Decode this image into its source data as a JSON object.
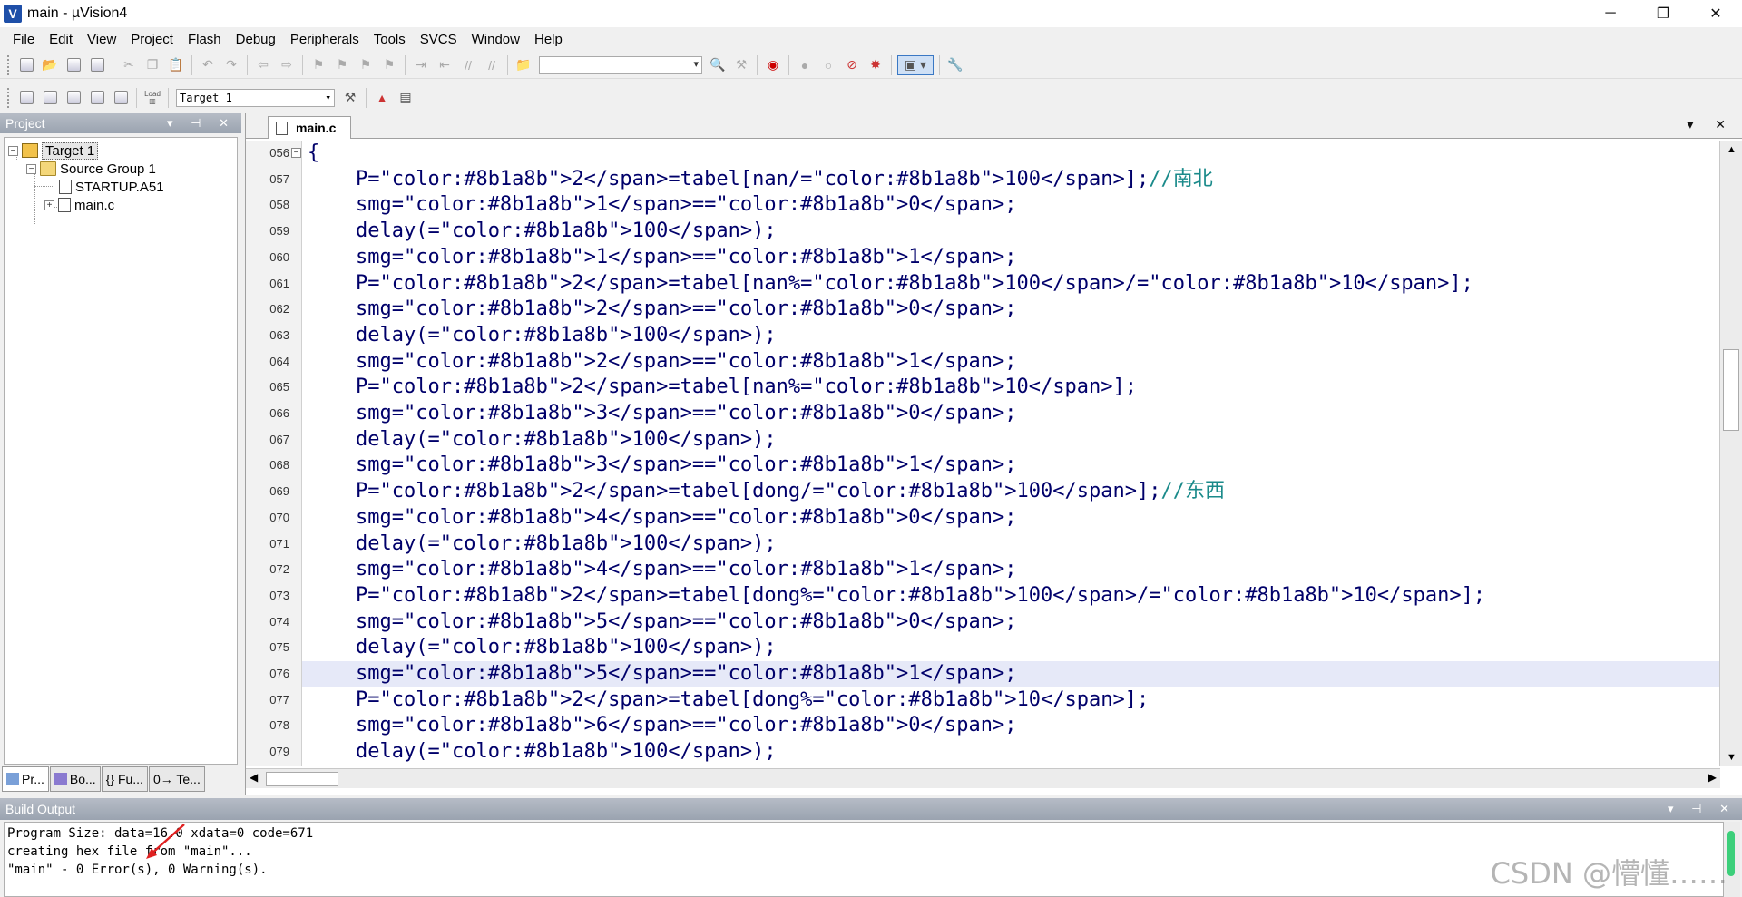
{
  "window": {
    "title": "main - µVision4",
    "app_icon_letter": "V",
    "minimize": "─",
    "maximize": "❐",
    "close": "✕"
  },
  "menu": [
    "File",
    "Edit",
    "View",
    "Project",
    "Flash",
    "Debug",
    "Peripherals",
    "Tools",
    "SVCS",
    "Window",
    "Help"
  ],
  "toolbar2": {
    "target_select": "Target 1",
    "load_label": "Load"
  },
  "project_panel": {
    "title": "Project",
    "controls": "▾ ⊣ ✕",
    "tree": {
      "target": "Target 1",
      "group": "Source Group 1",
      "files": [
        "STARTUP.A51",
        "main.c"
      ]
    },
    "tabs": [
      "Pr...",
      "Bo...",
      "{} Fu...",
      "0→ Te..."
    ]
  },
  "editor": {
    "tab_name": "main.c",
    "controls": "▾ ✕",
    "highlight_line": "076",
    "lines": [
      {
        "no": "056",
        "text": "{"
      },
      {
        "no": "057",
        "text": "    P2=tabel[nan/100];//南北"
      },
      {
        "no": "058",
        "text": "    smg1=0;"
      },
      {
        "no": "059",
        "text": "    delay(100);"
      },
      {
        "no": "060",
        "text": "    smg1=1;"
      },
      {
        "no": "061",
        "text": "    P2=tabel[nan%100/10];"
      },
      {
        "no": "062",
        "text": "    smg2=0;"
      },
      {
        "no": "063",
        "text": "    delay(100);"
      },
      {
        "no": "064",
        "text": "    smg2=1;"
      },
      {
        "no": "065",
        "text": "    P2=tabel[nan%10];"
      },
      {
        "no": "066",
        "text": "    smg3=0;"
      },
      {
        "no": "067",
        "text": "    delay(100);"
      },
      {
        "no": "068",
        "text": "    smg3=1;"
      },
      {
        "no": "069",
        "text": "    P2=tabel[dong/100];//东西"
      },
      {
        "no": "070",
        "text": "    smg4=0;"
      },
      {
        "no": "071",
        "text": "    delay(100);"
      },
      {
        "no": "072",
        "text": "    smg4=1;"
      },
      {
        "no": "073",
        "text": "    P2=tabel[dong%100/10];"
      },
      {
        "no": "074",
        "text": "    smg5=0;"
      },
      {
        "no": "075",
        "text": "    delay(100);"
      },
      {
        "no": "076",
        "text": "    smg5=1;"
      },
      {
        "no": "077",
        "text": "    P2=tabel[dong%10];"
      },
      {
        "no": "078",
        "text": "    smg6=0;"
      },
      {
        "no": "079",
        "text": "    delay(100);"
      }
    ]
  },
  "build_output": {
    "title": "Build Output",
    "controls": "▾ ⊣ ✕",
    "lines": [
      "Program Size: data=16.0 xdata=0 code=671",
      "creating hex file from \"main\"...",
      "\"main\" - 0 Error(s), 0 Warning(s)."
    ]
  },
  "watermark": "CSDN @懵懂……",
  "colors": {
    "code_text": "#00006a",
    "number": "#8b1a8b",
    "comment": "#1a8a8a",
    "highlight": "#e6e9f8",
    "panel_header": "#9aa3b0",
    "annotation_arrow": "#e02020"
  }
}
